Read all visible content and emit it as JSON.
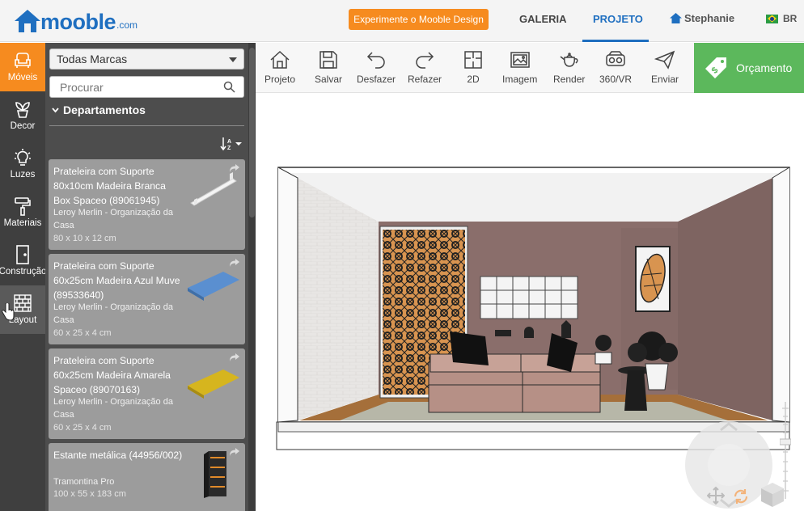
{
  "brand": {
    "name": "mooble",
    "suffix": ".com",
    "color": "#1f6fc0"
  },
  "header": {
    "promo_button": "Experimente o Mooble Design",
    "nav": {
      "galeria": "GALERIA",
      "projeto": "PROJETO"
    },
    "user": "Stephanie",
    "language": "BR"
  },
  "rail": {
    "items": [
      {
        "label": "Móveis",
        "icon": "armchair-icon"
      },
      {
        "label": "Decor",
        "icon": "plant-icon"
      },
      {
        "label": "Luzes",
        "icon": "bulb-icon"
      },
      {
        "label": "Materiais",
        "icon": "paint-roller-icon"
      },
      {
        "label": "Construção",
        "icon": "door-icon"
      },
      {
        "label": "Layout",
        "icon": "grid-icon"
      }
    ],
    "cursor_label_visible": "ayout"
  },
  "catalog": {
    "brand_select": "Todas Marcas",
    "search_placeholder": "Procurar",
    "department_label": "Departamentos",
    "items": [
      {
        "title": "Prateleira com Suporte 80x10cm Madeira Branca Box Spaceo (89061945)",
        "brand": "Leroy Merlin - Organização da Casa",
        "dims": "80 x 10 x 12 cm"
      },
      {
        "title": "Prateleira com Suporte 60x25cm Madeira Azul Muve (89533640)",
        "brand": "Leroy Merlin - Organização da Casa",
        "dims": "60 x 25 x 4 cm"
      },
      {
        "title": "Prateleira com Suporte 60x25cm Madeira Amarela Spaceo (89070163)",
        "brand": "Leroy Merlin - Organização da Casa",
        "dims": "60 x 25 x 4 cm"
      },
      {
        "title": "Estante metálica (44956/002)",
        "brand": "Tramontina Pro",
        "dims": "100 x 55 x 183 cm"
      }
    ]
  },
  "toolbar": {
    "tools": [
      {
        "label": "Projeto",
        "icon": "home-icon"
      },
      {
        "label": "Salvar",
        "icon": "save-icon"
      },
      {
        "label": "Desfazer",
        "icon": "undo-icon"
      },
      {
        "label": "Refazer",
        "icon": "redo-icon"
      },
      {
        "label": "2D",
        "icon": "floorplan-2d-icon"
      },
      {
        "label": "Imagem",
        "icon": "image-icon"
      },
      {
        "label": "Render",
        "icon": "teapot-icon"
      },
      {
        "label": "360/VR",
        "icon": "vr-headset-icon"
      },
      {
        "label": "Enviar",
        "icon": "send-icon"
      }
    ],
    "quote_button": "Orçamento"
  },
  "colors": {
    "accent_orange": "#f68b1f",
    "quote_green": "#5cb85c",
    "panel_dark": "#4d4d4d",
    "rail_dark": "#3f3f3f",
    "card_gray": "#9c9c9c"
  }
}
